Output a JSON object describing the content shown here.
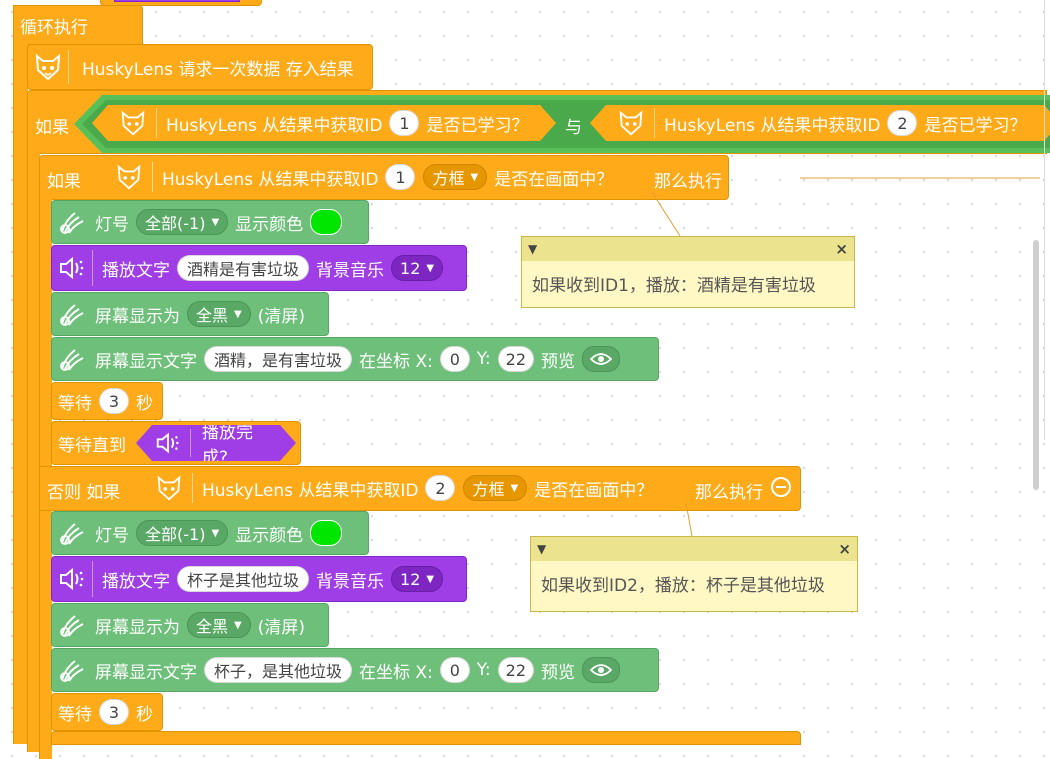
{
  "loop": {
    "label": "循环执行"
  },
  "request": {
    "label": "HuskyLens 请求一次数据 存入结果"
  },
  "cond_main": {
    "if_label": "如果",
    "left": {
      "prefix": "HuskyLens 从结果中获取ID",
      "id": "1",
      "suffix": "是否已学习？"
    },
    "and_label": "与",
    "right": {
      "prefix": "HuskyLens 从结果中获取ID",
      "id": "2",
      "suffix": "是否已学习？"
    }
  },
  "branch1": {
    "if_label": "如果",
    "prefix": "HuskyLens 从结果中获取ID",
    "id": "1",
    "shape": "方框",
    "suffix": "是否在画面中？",
    "then": "那么执行"
  },
  "branch2": {
    "if_label": "否则 如果",
    "prefix": "HuskyLens 从结果中获取ID",
    "id": "2",
    "shape": "方框",
    "suffix": "是否在画面中？",
    "then": "那么执行"
  },
  "stmts1": {
    "led": {
      "label": "灯号",
      "target": "全部(-1)",
      "suffix": "显示颜色"
    },
    "play": {
      "label": "播放文字",
      "text": "酒精是有害垃圾",
      "bg_label": "背景音乐",
      "bg_val": "12"
    },
    "screen": {
      "label": "屏幕显示为",
      "mode": "全黑",
      "suffix": "(清屏)"
    },
    "screen_text": {
      "label": "屏幕显示文字",
      "text": "酒精，是有害垃圾",
      "coord_label": "在坐标 X:",
      "x": "0",
      "y_label": "Y:",
      "y": "22",
      "preview": "预览"
    },
    "wait": {
      "label": "等待",
      "val": "3",
      "unit": "秒"
    },
    "wait_until": {
      "label": "等待直到",
      "cond": "播放完成?"
    }
  },
  "stmts2": {
    "led": {
      "label": "灯号",
      "target": "全部(-1)",
      "suffix": "显示颜色"
    },
    "play": {
      "label": "播放文字",
      "text": "杯子是其他垃圾",
      "bg_label": "背景音乐",
      "bg_val": "12"
    },
    "screen": {
      "label": "屏幕显示为",
      "mode": "全黑",
      "suffix": "(清屏)"
    },
    "screen_text": {
      "label": "屏幕显示文字",
      "text": "杯子，是其他垃圾",
      "coord_label": "在坐标 X:",
      "x": "0",
      "y_label": "Y:",
      "y": "22",
      "preview": "预览"
    },
    "wait": {
      "label": "等待",
      "val": "3",
      "unit": "秒"
    }
  },
  "comments": [
    {
      "text": "如果收到ID1，播放：酒精是有害垃圾"
    },
    {
      "text": "如果收到ID2，播放：杯子是其他垃圾"
    }
  ],
  "colors": {
    "control": "#ffab19",
    "green": "#6ebf7a",
    "purple": "#9f3ee6",
    "led": "#00e600",
    "logic": "#59c059"
  }
}
